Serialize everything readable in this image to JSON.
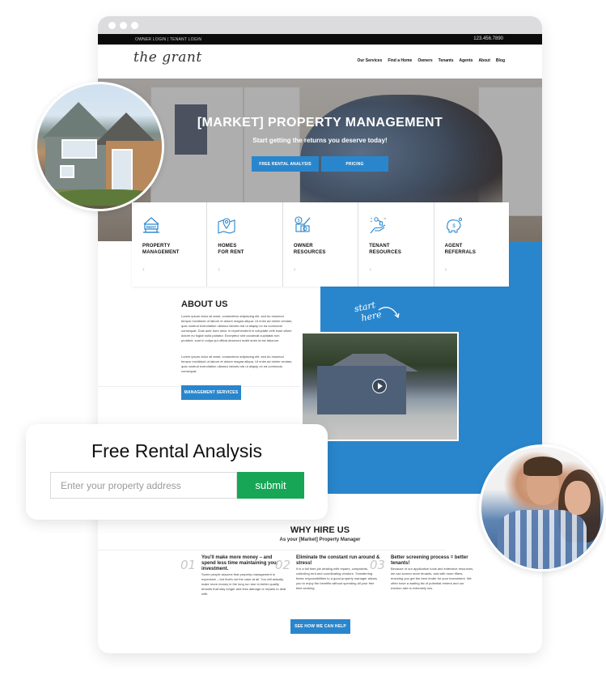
{
  "browser": {
    "topbar": {
      "logins": "OWNER LOGIN  |  TENANT LOGIN",
      "phone": "123.456.7890"
    },
    "logo": "the grant",
    "nav": [
      "Our Services",
      "Find a Home",
      "Owners",
      "Tenants",
      "Agents",
      "About",
      "Blog"
    ]
  },
  "hero": {
    "title": "[MARKET] PROPERTY MANAGEMENT",
    "subtitle": "Start getting the returns you deserve today!",
    "buttons": [
      "FREE RENTAL ANALYSIS",
      "PRICING"
    ]
  },
  "cards": [
    {
      "title_line1": "PROPERTY",
      "title_line2": "MANAGEMENT",
      "icon": "rent-house-icon"
    },
    {
      "title_line1": "HOMES",
      "title_line2": "FOR RENT",
      "icon": "map-pin-icon"
    },
    {
      "title_line1": "OWNER",
      "title_line2": "RESOURCES",
      "icon": "money-documents-icon"
    },
    {
      "title_line1": "TENANT",
      "title_line2": "RESOURCES",
      "icon": "key-hand-icon"
    },
    {
      "title_line1": "AGENT",
      "title_line2": "REFERRALS",
      "icon": "piggy-bank-icon"
    }
  ],
  "card_chevron": "›",
  "about": {
    "title": "ABOUT US",
    "paragraph1": "Lorem ipsum dolor sit amet, consectetur adipiscing elit, sed do eiusmod tempor incididunt ut labore et dolore magna aliqua. Ut enim ad minim veniam, quis nostrud exercitation ullamco laboris nisi ut aliquip ex ea commodo consequat. Duis aute irure dolor in reprehenderit in voluptate velit esse cillum dolore eu fugiat nulla pariatur. Excepteur sint occaecat cupidatat non proident, sunt in culpa qui officia deserunt mollit anim id est laborum.",
    "paragraph2": "Lorem ipsum dolor sit amet, consectetur adipiscing elit, sed do eiusmod tempor incididunt ut labore et dolore magna aliqua. Ut enim ad minim veniam, quis nostrud exercitation ullamco laboris nisi ut aliquip ex ea commodo consequat.",
    "button": "MANAGEMENT SERVICES",
    "start_here_line1": "start",
    "start_here_line2": "here"
  },
  "why": {
    "title": "WHY HIRE US",
    "subtitle": "As your [Market] Property Manager",
    "features": [
      {
        "num": "01",
        "heading": "You'll make more money – and spend less time maintaining your investment.",
        "body": "Some people assume that property management is expensive – but that's not the case at all. You will actually make more money in the long run due to better quality tenants that stay longer and less damage or repairs to deal with."
      },
      {
        "num": "02",
        "heading": "Eliminate the constant run around & stress!",
        "body": "It is a full time job dealing with repairs, complaints, collecting rent and coordinating vendors. Transferring these responsibilities to a good property manager allows you to enjoy the benefits without spending all your free time working."
      },
      {
        "num": "03",
        "heading": "Better screening process = better tenants!",
        "body": "Because of our application tools and extensive resources, we can screen more tenants, and with more filters, ensuring you get the best renter for your investment. We often have a waiting list of potential renters and our eviction rate is extremely low."
      }
    ],
    "button": "SEE HOW WE CAN HELP"
  },
  "rental_form": {
    "title": "Free Rental Analysis",
    "placeholder": "Enter your property address",
    "value": "",
    "submit": "submit"
  },
  "colors": {
    "accent_blue": "#2a86cc",
    "submit_green": "#17a655",
    "topbar_black": "#0b0b0b"
  }
}
